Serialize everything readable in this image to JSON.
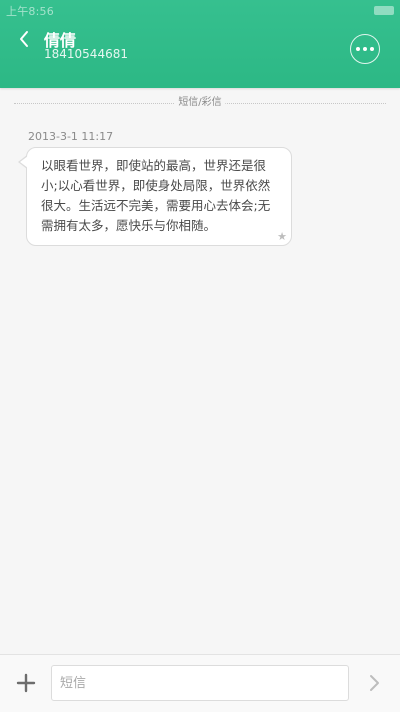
{
  "status_bar": {
    "time": "上午8:56"
  },
  "header": {
    "contact_name": "倩倩",
    "contact_number": "18410544681",
    "back_icon": "chevron-left-icon",
    "more_icon": "more-horizontal-icon"
  },
  "conversation": {
    "divider_label": "短信/彩信",
    "messages": [
      {
        "timestamp": "2013-3-1 11:17",
        "text": "以眼看世界，即使站的最高，世界还是很小;以心看世界，即使身处局限，世界依然很大。生活远不完美，需要用心去体会;无需拥有太多，愿快乐与你相随。",
        "starred_icon": "star-icon"
      }
    ]
  },
  "compose": {
    "add_icon": "plus-icon",
    "input_placeholder": "短信",
    "input_value": "",
    "send_icon": "chevron-right-icon"
  },
  "colors": {
    "header_bg": "#2fbb89",
    "page_bg": "#f6f6f6",
    "bubble_bg": "#ffffff",
    "bubble_border": "#dcdcdc"
  }
}
